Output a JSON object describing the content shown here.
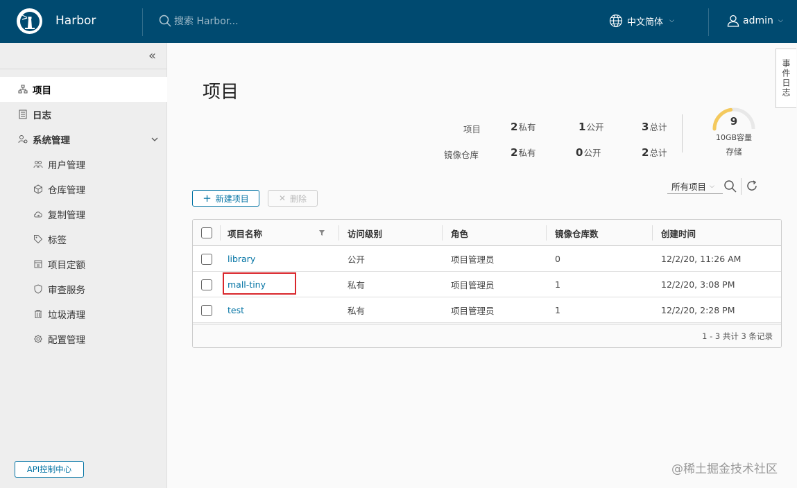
{
  "header": {
    "app_title": "Harbor",
    "search_placeholder": "搜索 Harbor...",
    "language": "中文简体",
    "user": "admin"
  },
  "sidebar": {
    "items": [
      {
        "label": "项目",
        "icon": "projects-icon",
        "active": true
      },
      {
        "label": "日志",
        "icon": "logs-icon"
      },
      {
        "label": "系统管理",
        "icon": "admin-icon"
      }
    ],
    "sub_items": [
      {
        "label": "用户管理",
        "icon": "users-icon"
      },
      {
        "label": "仓库管理",
        "icon": "registry-icon"
      },
      {
        "label": "复制管理",
        "icon": "replication-icon"
      },
      {
        "label": "标签",
        "icon": "tag-icon"
      },
      {
        "label": "项目定额",
        "icon": "quota-icon"
      },
      {
        "label": "审查服务",
        "icon": "shield-icon"
      },
      {
        "label": "垃圾清理",
        "icon": "trash-icon"
      },
      {
        "label": "配置管理",
        "icon": "gear-icon"
      }
    ],
    "api_button": "API控制中心"
  },
  "event_tab": "事件日志",
  "page": {
    "title": "项目"
  },
  "stats": {
    "row1_label": "项目",
    "row1_private": "2",
    "row1_public": "1",
    "row1_total": "3",
    "row2_label": "镜像仓库",
    "row2_private": "2",
    "row2_public": "0",
    "row2_total": "2",
    "private_label": "私有",
    "public_label": "公开",
    "total_label": "总计",
    "storage_value": "9",
    "storage_capacity": "10GB容量",
    "storage_label": "存储",
    "storage_fraction": 0.45
  },
  "toolbar": {
    "new_project": "新建项目",
    "delete": "删除",
    "filter_value": "所有项目"
  },
  "table": {
    "columns": [
      "项目名称",
      "访问级别",
      "角色",
      "镜像仓库数",
      "创建时间"
    ],
    "rows": [
      {
        "name": "library",
        "access": "公开",
        "role": "项目管理员",
        "repo_count": "0",
        "created": "12/2/20, 11:26 AM"
      },
      {
        "name": "mall-tiny",
        "access": "私有",
        "role": "项目管理员",
        "repo_count": "1",
        "created": "12/2/20, 3:08 PM"
      },
      {
        "name": "test",
        "access": "私有",
        "role": "项目管理员",
        "repo_count": "1",
        "created": "12/2/20, 2:28 PM"
      }
    ],
    "footer": "1 - 3 共计 3 条记录"
  },
  "watermark": "@稀土掘金技术社区",
  "colors": {
    "header_bg": "#004a70",
    "accent": "#0072a3",
    "highlight": "#d9262b",
    "gauge": "#f4c95d"
  }
}
